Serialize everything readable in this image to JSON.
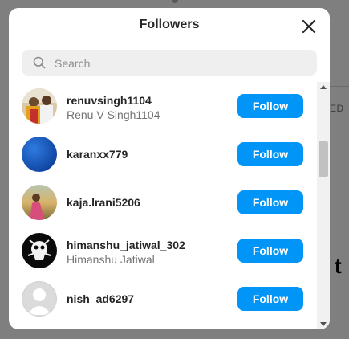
{
  "background": {
    "partial_text_right": "ED",
    "partial_heading_right": "t"
  },
  "modal": {
    "title": "Followers",
    "close_icon": "close-icon",
    "search": {
      "icon": "search-icon",
      "placeholder": "Search",
      "value": ""
    },
    "followers": [
      {
        "username": "renuvsingh1104",
        "full_name": "Renu V Singh1104",
        "button_label": "Follow"
      },
      {
        "username": "karanxx779",
        "full_name": "",
        "button_label": "Follow"
      },
      {
        "username": "kaja.lrani5206",
        "full_name": "",
        "button_label": "Follow"
      },
      {
        "username": "himanshu_jatiwal_302",
        "full_name": "Himanshu Jatiwal",
        "button_label": "Follow"
      },
      {
        "username": "nish_ad6297",
        "full_name": "",
        "button_label": "Follow"
      }
    ]
  },
  "colors": {
    "accent": "#0095f6",
    "overlay": "#7f7f7f",
    "text_primary": "#262626",
    "text_secondary": "#737373"
  }
}
